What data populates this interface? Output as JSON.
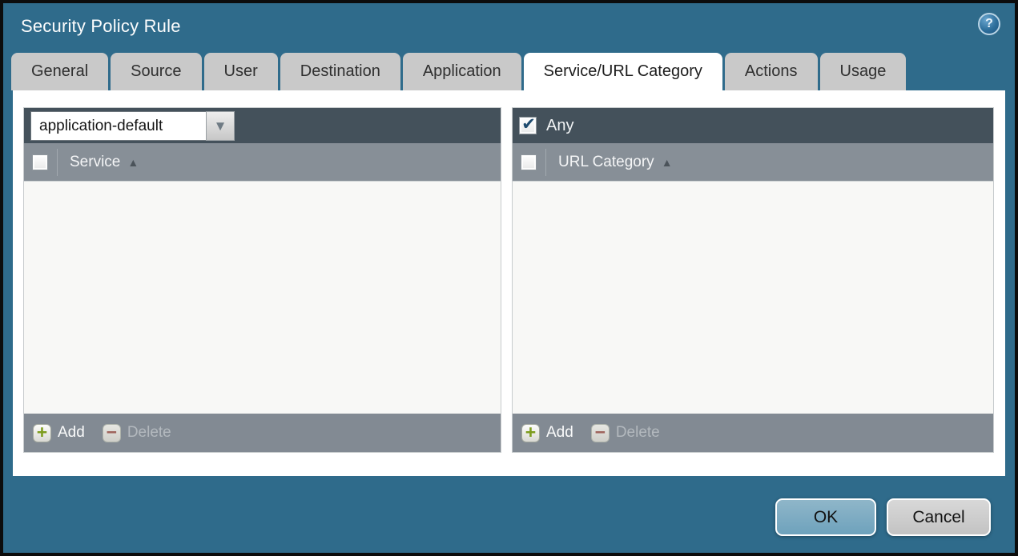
{
  "window": {
    "title": "Security Policy Rule"
  },
  "icons": {
    "help": "?",
    "dropdown_arrow": "▼",
    "sort_asc": "▲",
    "check": "✔",
    "add": "+",
    "delete": "−"
  },
  "tabs": [
    {
      "label": "General",
      "active": false
    },
    {
      "label": "Source",
      "active": false
    },
    {
      "label": "User",
      "active": false
    },
    {
      "label": "Destination",
      "active": false
    },
    {
      "label": "Application",
      "active": false
    },
    {
      "label": "Service/URL Category",
      "active": true
    },
    {
      "label": "Actions",
      "active": false
    },
    {
      "label": "Usage",
      "active": false
    }
  ],
  "service_panel": {
    "dropdown_value": "application-default",
    "column_header": "Service",
    "rows": [],
    "add_label": "Add",
    "delete_label": "Delete",
    "delete_enabled": false
  },
  "url_category_panel": {
    "any_label": "Any",
    "any_checked": true,
    "column_header": "URL Category",
    "rows": [],
    "add_label": "Add",
    "delete_label": "Delete",
    "delete_enabled": false
  },
  "dialog_actions": {
    "ok_label": "OK",
    "cancel_label": "Cancel"
  },
  "colors": {
    "background_teal": "#2f6b8b",
    "dark_bar": "#44515b",
    "header_gray": "#878f97",
    "footer_gray": "#828a93",
    "active_tab": "#ffffff",
    "inactive_tab": "#c9c9c9",
    "ok_button": "#72a5bf",
    "cancel_button": "#cbcbcb",
    "check_blue": "#1d4a6e",
    "add_green": "#7d9c1d",
    "delete_red": "#8a3c34"
  }
}
